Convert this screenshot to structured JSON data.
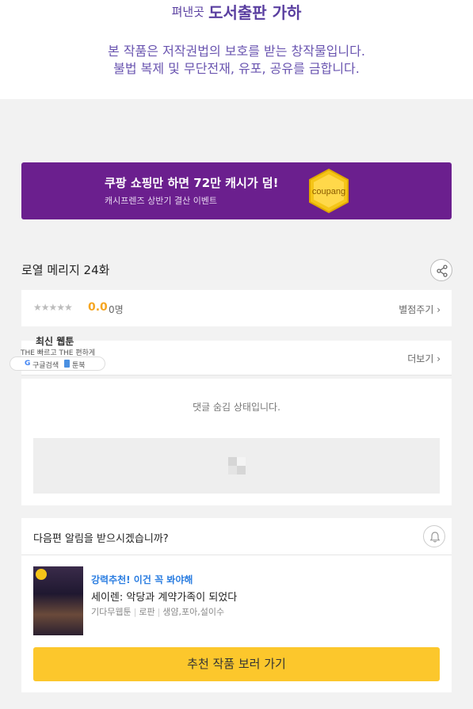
{
  "publisher": {
    "prefix": "펴낸곳",
    "name": "도서출판 가하"
  },
  "copyright": {
    "line1": "본 작품은 저작권법의 보호를 받는 창작물입니다.",
    "line2": "불법 복제 및 무단전재, 유포, 공유를 금합니다."
  },
  "banner": {
    "title": "쿠팡 쇼핑만 하면 72만 캐시가 덤!",
    "subtitle": "캐시프렌즈 상반기 결산 이벤트",
    "badge": "coupang",
    "bg_color": "#6b1f8e",
    "badge_color": "#f5c518"
  },
  "episode": {
    "title": "로열 메리지 24화"
  },
  "rating": {
    "stars": "★★★★★",
    "score": "0.0",
    "count": "0명",
    "rate_link": "별점주기 ›"
  },
  "comments": {
    "more_link": "더보기 ›",
    "hidden_message": "댓글 숨김 상태입니다."
  },
  "overlay": {
    "title": "최신 웹툰",
    "subtitle": "THE 빠르고 THE 편하게",
    "google_label": "구글검색",
    "book_label": "툰북"
  },
  "notify": {
    "question": "다음편 알림을 받으시겠습니까?"
  },
  "recommend": {
    "tag": "강력추천! 이건 꼭 봐야해",
    "title": "세이렌: 악당과 계약가족이 되었다",
    "meta": [
      "기다무웹툰",
      "로판",
      "생얌,포아,설이수"
    ],
    "cta": "추천 작품 보러 가기",
    "cta_color": "#fcc72c"
  },
  "icons": [
    "share-icon",
    "bell-icon",
    "star-icon",
    "clock-icon",
    "google-icon",
    "book-icon",
    "chevron-right-icon"
  ]
}
